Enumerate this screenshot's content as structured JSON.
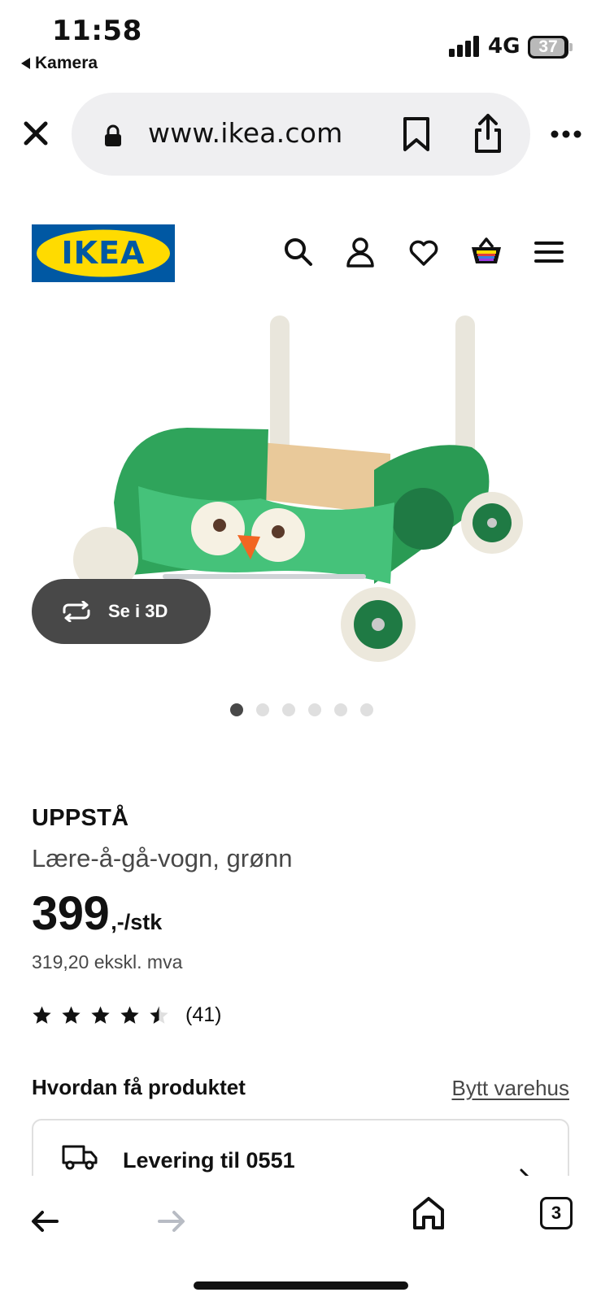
{
  "status_bar": {
    "time": "11:58",
    "back_app": "Kamera",
    "network": "4G",
    "battery": "37"
  },
  "browser": {
    "url": "www.ikea.com",
    "icons": [
      "close-icon",
      "lock-icon",
      "bookmark-icon",
      "share-icon",
      "more-icon"
    ]
  },
  "header": {
    "logo_text": "IKEA",
    "icons": [
      "search-icon",
      "account-icon",
      "heart-icon",
      "basket-icon",
      "menu-icon"
    ],
    "colors": {
      "logo_blue": "#0058a3",
      "logo_yellow": "#ffdb00"
    }
  },
  "gallery": {
    "view_3d_label": "Se i 3D",
    "dots_total": 6,
    "active_dot": 1
  },
  "product": {
    "name": "UPPSTÅ",
    "description": "Lære-å-gå-vogn, grønn",
    "price": "399",
    "price_suffix": ",-/stk",
    "price_ex_vat": "319,20 ekskl. mva",
    "rating": 4.5,
    "rating_max": 5,
    "review_count": "(41)"
  },
  "fulfillment": {
    "heading": "Hvordan få produktet",
    "change_store": "Bytt varehus",
    "delivery_label": "Levering til 0551"
  },
  "toolbar": {
    "tab_count": "3"
  }
}
